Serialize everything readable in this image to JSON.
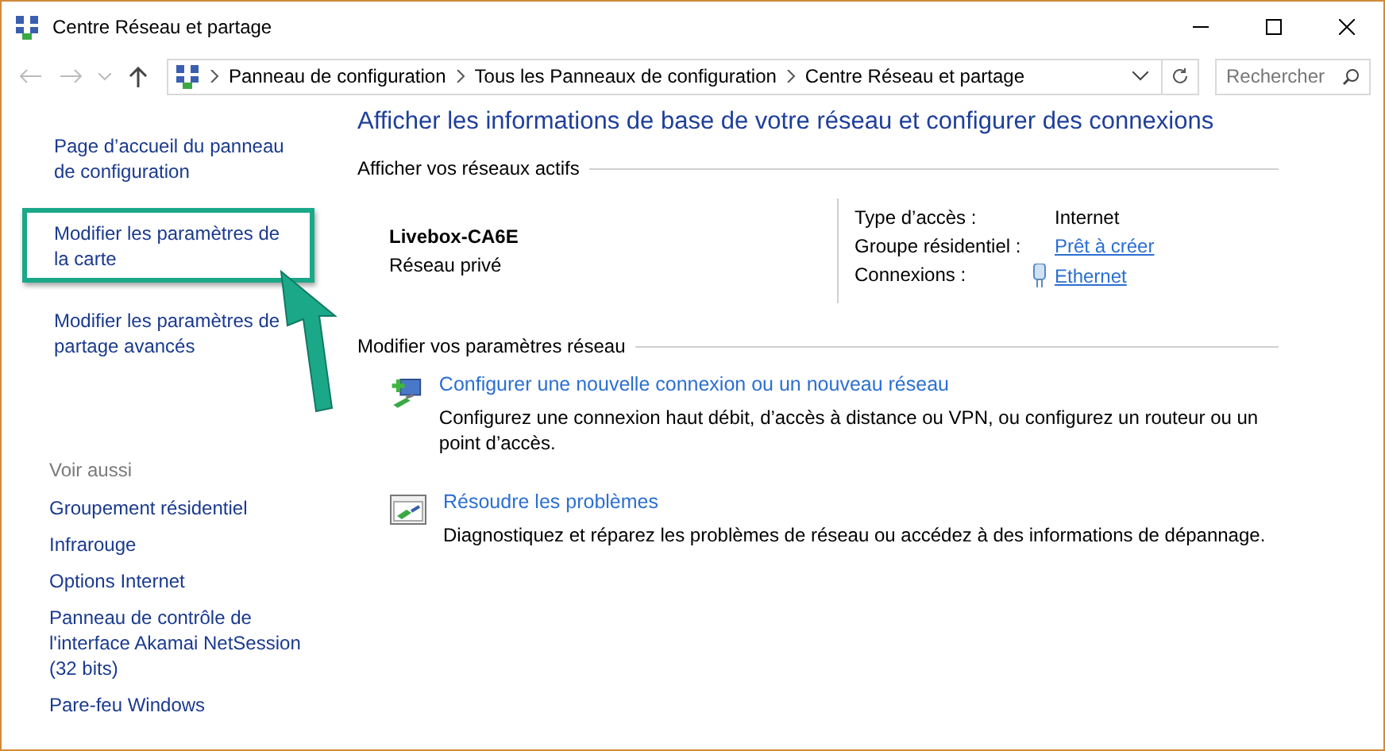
{
  "window": {
    "title": "Centre Réseau et partage"
  },
  "address_bar": {
    "breadcrumbs": [
      "Panneau de configuration",
      "Tous les Panneaux de configuration",
      "Centre Réseau et partage"
    ]
  },
  "search": {
    "placeholder": "Rechercher"
  },
  "sidebar": {
    "tasks": [
      {
        "label": "Page d’accueil du panneau de configuration",
        "highlighted": false
      },
      {
        "label": "Modifier les paramètres de la carte",
        "highlighted": true
      },
      {
        "label": "Modifier les paramètres de partage avancés",
        "highlighted": false
      }
    ],
    "see_also_title": "Voir aussi",
    "see_also": [
      "Groupement résidentiel",
      "Infrarouge",
      "Options Internet",
      "Panneau de contrôle de l'interface Akamai NetSession (32 bits)",
      "Pare-feu Windows"
    ]
  },
  "main": {
    "heading": "Afficher les informations de base de votre réseau et configurer des connexions",
    "active_networks": {
      "title": "Afficher vos réseaux actifs",
      "network_name": "Livebox-CA6E",
      "network_type": "Réseau privé",
      "properties": [
        {
          "label": "Type d’accès :",
          "value": "Internet",
          "kind": "text"
        },
        {
          "label": "Groupe résidentiel :",
          "value": "Prêt à créer",
          "kind": "link"
        },
        {
          "label": "Connexions :",
          "value": "Ethernet",
          "kind": "connection"
        }
      ]
    },
    "settings": {
      "title": "Modifier vos paramètres réseau",
      "items": [
        {
          "kind": "new-connection",
          "link": "Configurer une nouvelle connexion ou un nouveau réseau",
          "description": "Configurez une connexion haut débit, d’accès à distance ou VPN, ou configurez un routeur ou un point d’accès."
        },
        {
          "kind": "troubleshoot",
          "link": "Résoudre les problèmes",
          "description": "Diagnostiquez et réparez les problèmes de réseau ou accédez à des informations de dépannage."
        }
      ]
    }
  }
}
